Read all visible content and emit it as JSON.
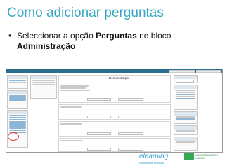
{
  "slide": {
    "title": "Como adicionar perguntas",
    "bullet_prefix": "Seleccionar a opção ",
    "bullet_bold": "Perguntas",
    "bullet_mid": " no bloco ",
    "bullet_bold2": "Administração"
  },
  "moodle": {
    "center_label": "Demonstração",
    "highlight_color": "#e23b3b"
  },
  "logos": {
    "elearning": "elearning",
    "elearning_sub": "universidade de lisboa",
    "ulisboa": "UNIVERSIDADE DE LISBOA"
  }
}
